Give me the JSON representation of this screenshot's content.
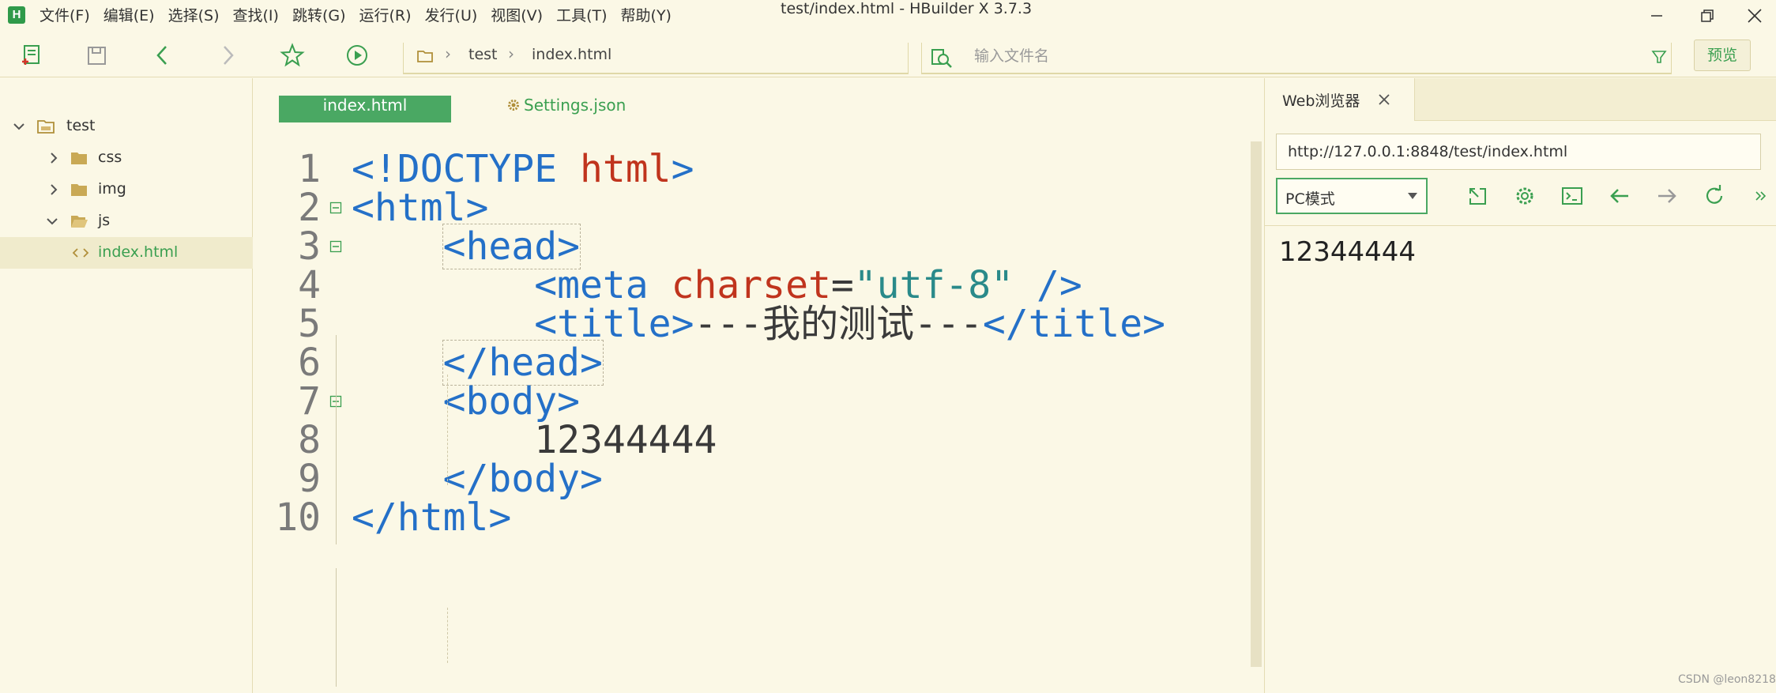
{
  "app": {
    "logo_letter": "H",
    "window_title": "test/index.html - HBuilder X 3.7.3",
    "menu": [
      "文件(F)",
      "编辑(E)",
      "选择(S)",
      "查找(I)",
      "跳转(G)",
      "运行(R)",
      "发行(U)",
      "视图(V)",
      "工具(T)",
      "帮助(Y)"
    ]
  },
  "toolbar": {
    "breadcrumb": [
      "test",
      "index.html"
    ],
    "search_placeholder": "输入文件名",
    "preview_label": "预览"
  },
  "sidebar": {
    "items": [
      {
        "label": "test",
        "type": "folder",
        "expanded": true
      },
      {
        "label": "css",
        "type": "folder",
        "expanded": false
      },
      {
        "label": "img",
        "type": "folder",
        "expanded": false
      },
      {
        "label": "js",
        "type": "folder",
        "expanded": true
      },
      {
        "label": "index.html",
        "type": "file",
        "selected": true
      }
    ]
  },
  "editor": {
    "tabs": [
      {
        "label": "index.html",
        "active": true
      },
      {
        "label": "Settings.json",
        "active": false
      }
    ],
    "lines": [
      {
        "num": "1",
        "tokens": [
          [
            "tk-punc",
            "<!DOCTYPE "
          ],
          [
            "tk-html-word",
            "html"
          ],
          [
            "tk-punc",
            ">"
          ]
        ]
      },
      {
        "num": "2",
        "tokens": [
          [
            "tk-tag",
            "<html>"
          ]
        ]
      },
      {
        "num": "3",
        "tokens": [
          [
            "tk-text",
            "    "
          ],
          [
            "tk-tag bracket-box",
            "<head>"
          ]
        ]
      },
      {
        "num": "4",
        "tokens": [
          [
            "tk-text",
            "        "
          ],
          [
            "tk-tag",
            "<meta "
          ],
          [
            "tk-attr",
            "charset"
          ],
          [
            "tk-text",
            "="
          ],
          [
            "tk-str",
            "\"utf-8\""
          ],
          [
            "tk-tag",
            " />"
          ]
        ]
      },
      {
        "num": "5",
        "tokens": [
          [
            "tk-text",
            "        "
          ],
          [
            "tk-tag",
            "<title>"
          ],
          [
            "tk-text",
            "---我的测试---"
          ],
          [
            "tk-tag",
            "</title>"
          ]
        ]
      },
      {
        "num": "6",
        "tokens": [
          [
            "tk-text",
            "    "
          ],
          [
            "tk-tag bracket-box",
            "</head>"
          ]
        ]
      },
      {
        "num": "7",
        "tokens": [
          [
            "tk-text",
            "    "
          ],
          [
            "tk-tag",
            "<body>"
          ]
        ]
      },
      {
        "num": "8",
        "tokens": [
          [
            "tk-text",
            "        12344444"
          ]
        ]
      },
      {
        "num": "9",
        "tokens": [
          [
            "tk-text",
            "    "
          ],
          [
            "tk-tag",
            "</body>"
          ]
        ]
      },
      {
        "num": "10",
        "tokens": [
          [
            "tk-tag",
            "</html>"
          ]
        ]
      }
    ]
  },
  "browser": {
    "tab_label": "Web浏览器",
    "url": "http://127.0.0.1:8848/test/index.html",
    "mode": "PC模式",
    "page_text": "12344444"
  },
  "watermark": "CSDN @leon8218",
  "colors": {
    "accent": "#4aa863",
    "background": "#fbf8e6",
    "tag": "#2470c8",
    "attr": "#c0341d",
    "string": "#2a8a8a"
  },
  "icons": {
    "toolbar": [
      "new-file-icon",
      "save-icon",
      "back-icon",
      "forward-icon",
      "favorite-star-icon",
      "run-icon"
    ],
    "browser": [
      "detach-icon",
      "settings-gear-icon",
      "console-icon",
      "back-arrow-icon",
      "forward-arrow-icon",
      "refresh-icon",
      "more-chevron-icon"
    ]
  }
}
